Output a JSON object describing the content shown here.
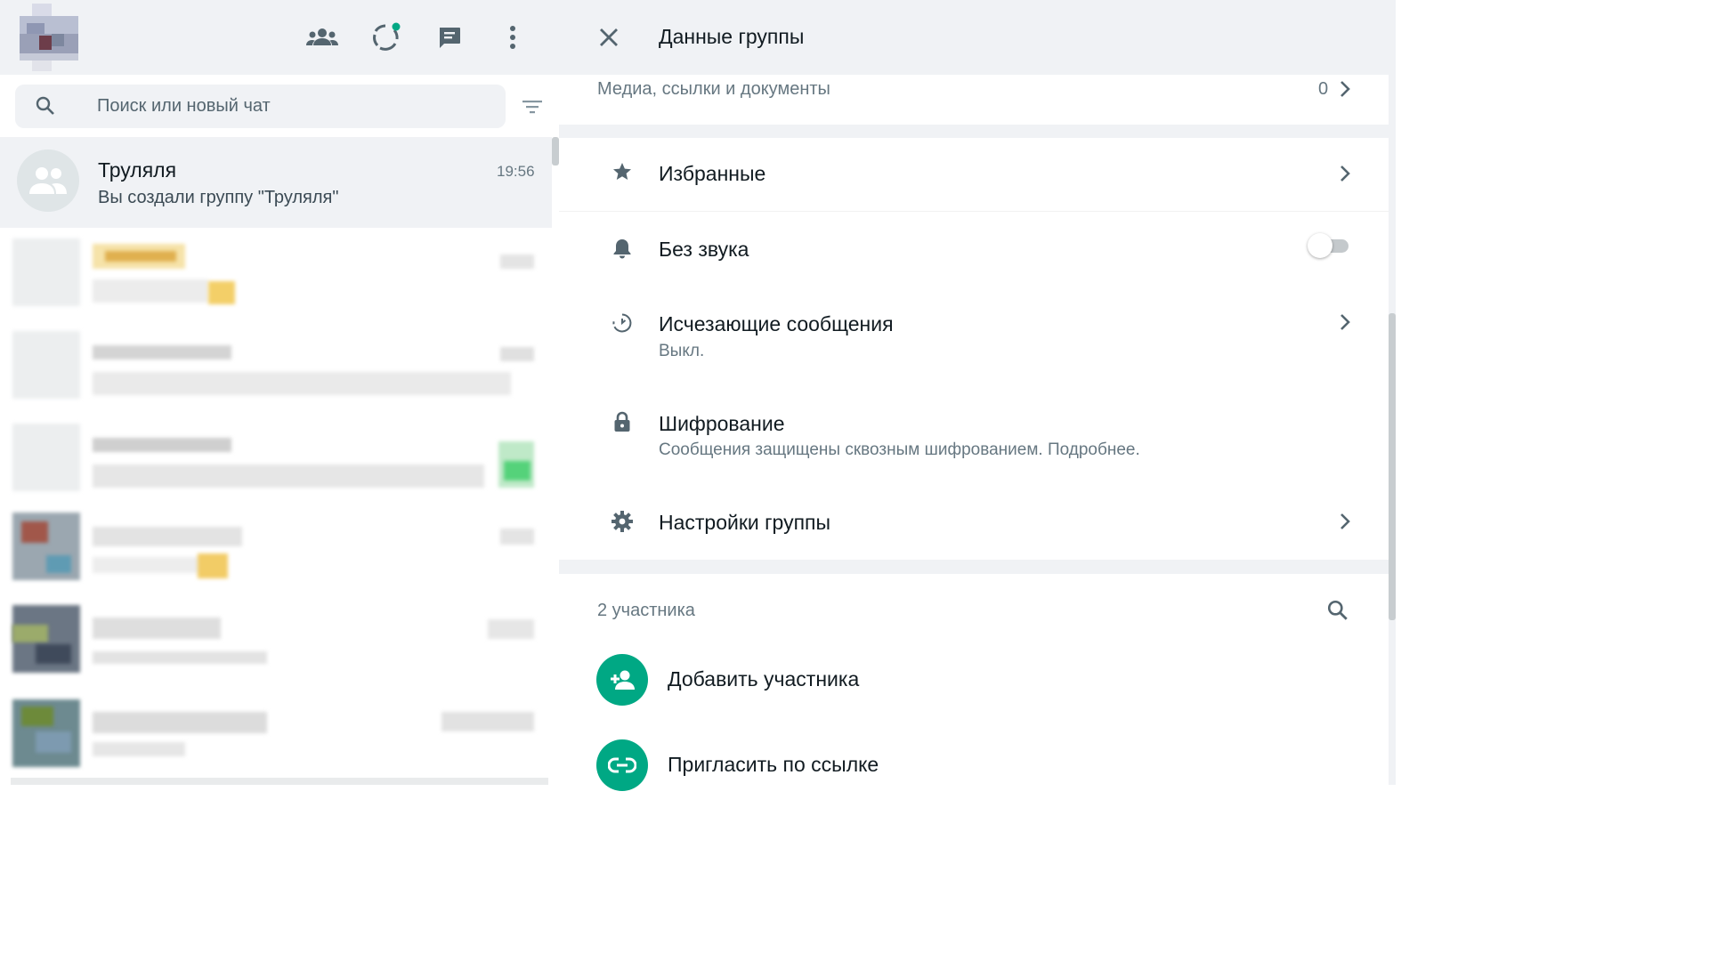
{
  "left_pane": {
    "header": {
      "icons": [
        "communities-icon",
        "status-icon",
        "new-chat-icon",
        "menu-icon"
      ],
      "status_dot_color": "#00a884"
    },
    "search": {
      "placeholder": "Поиск или новый чат"
    },
    "active_chat": {
      "name": "Труляля",
      "time": "19:56",
      "last_message": "Вы создали группу \"Труляля\""
    }
  },
  "right_pane": {
    "title": "Данные группы",
    "media": {
      "label": "Медиа, ссылки и документы",
      "count": "0"
    },
    "options": {
      "starred": {
        "title": "Избранные"
      },
      "mute": {
        "title": "Без звука",
        "enabled": false
      },
      "disappearing": {
        "title": "Исчезающие сообщения",
        "subtitle": "Выкл."
      },
      "encryption": {
        "title": "Шифрование",
        "subtitle": "Сообщения защищены сквозным шифрованием. Подробнее."
      },
      "group_settings": {
        "title": "Настройки группы"
      }
    },
    "participants": {
      "count_label": "2 участника",
      "add_label": "Добавить участника",
      "invite_label": "Пригласить по ссылке"
    }
  },
  "colors": {
    "accent": "#00a884",
    "header_bg": "#f0f2f5",
    "icon_gray": "#54656f",
    "secondary_text": "#667781"
  }
}
